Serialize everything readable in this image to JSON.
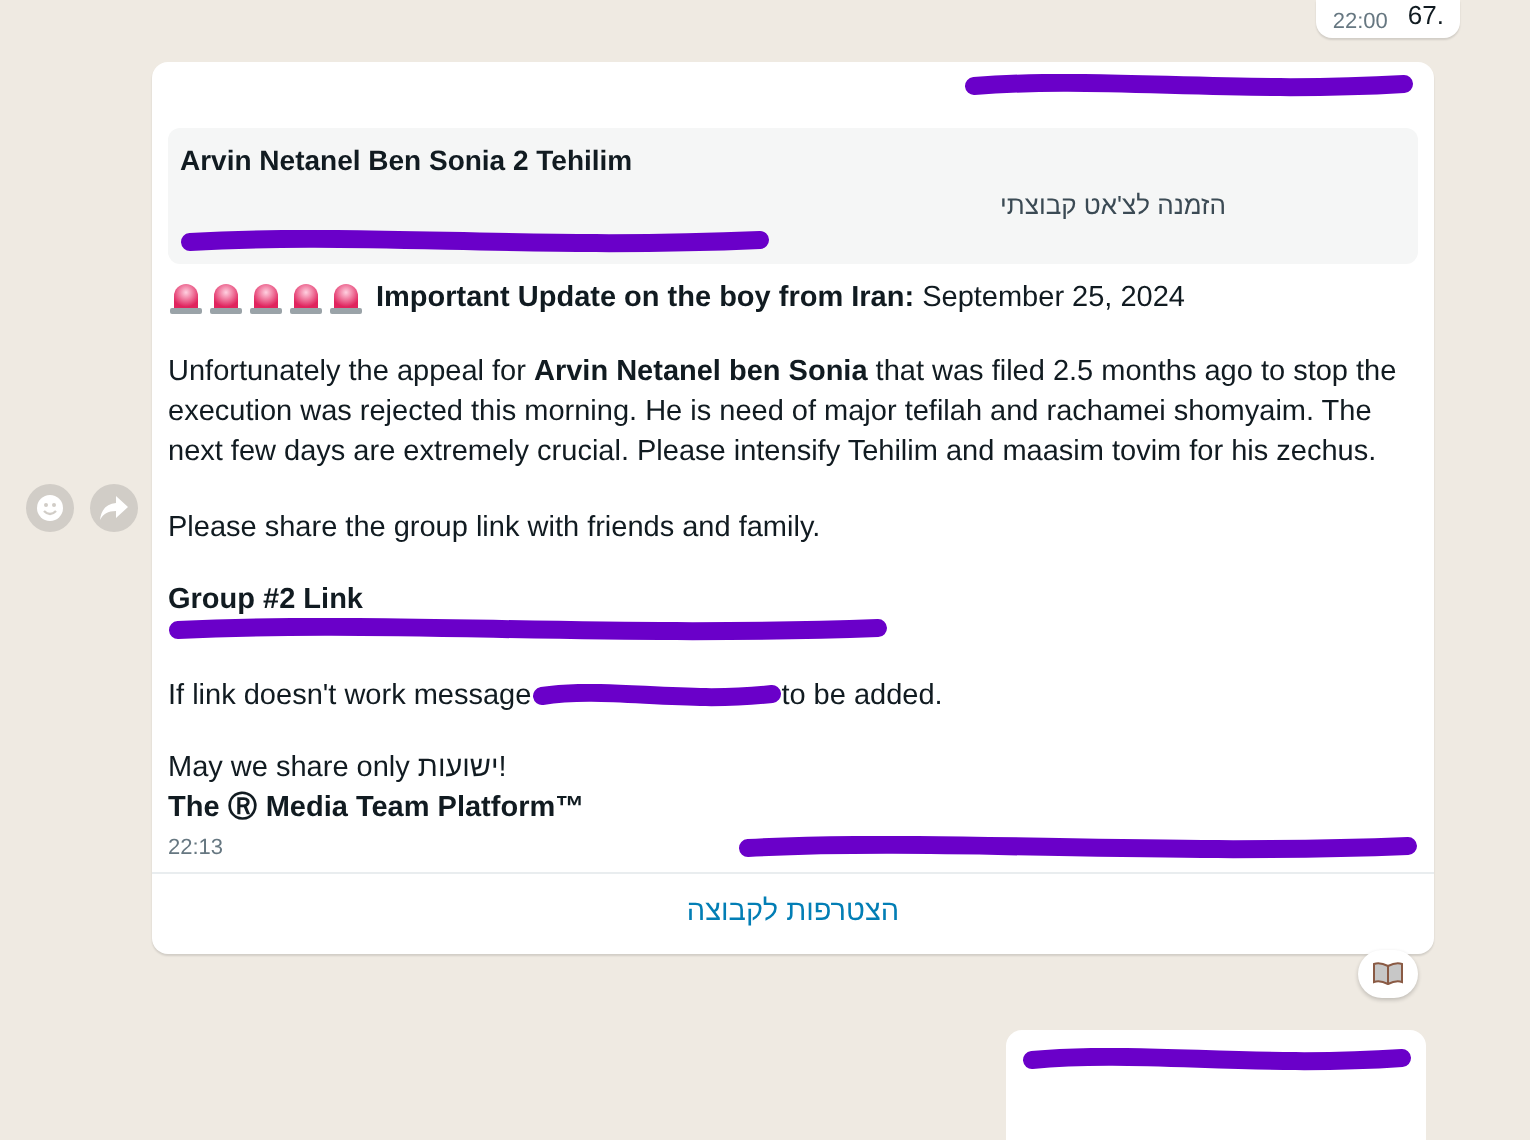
{
  "top_message": {
    "text": "67.",
    "time": "22:00"
  },
  "message": {
    "link_preview": {
      "title": "Arvin Netanel Ben Sonia 2 Tehilim",
      "description": "הזמנה לצ'אט קבוצתי"
    },
    "alert_icons": [
      {
        "kind": "siren"
      },
      {
        "kind": "siren"
      },
      {
        "kind": "siren"
      },
      {
        "kind": "siren"
      },
      {
        "kind": "siren"
      }
    ],
    "headline": "**Important Update on the boy from Iran:** September 25, 2024",
    "paragraphs": [
      "Unfortunately the appeal for **Arvin Netanel ben Sonia** that was filed 2.5 months ago to stop the execution was rejected this morning. He is need of major tefilah and rachamei shomyaim. The next few days are extremely crucial. Please intensify Tehilim and maasim tovim for his zechus.",
      "Please share the group link with friends and family."
    ],
    "group_link_label": "Group #2 Link",
    "contact_line": {
      "before": "If link doesn't work message",
      "after": "to be added."
    },
    "closing": "May we share only ישועות!",
    "signature": "The Ⓡ Media Team Platform™",
    "time": "22:13",
    "action_button": "הצטרפות לקבוצה"
  }
}
